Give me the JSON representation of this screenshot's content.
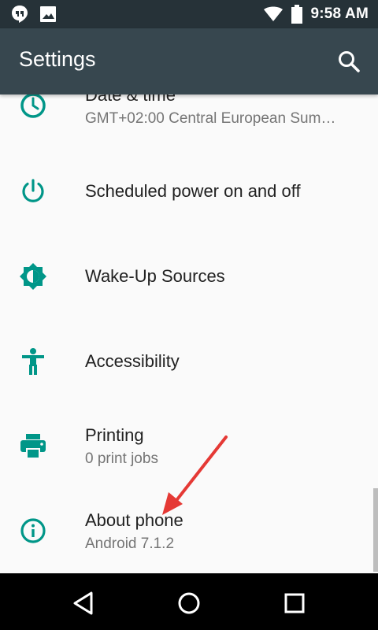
{
  "status_bar": {
    "time": "9:58 AM"
  },
  "app_bar": {
    "title": "Settings"
  },
  "settings_items": [
    {
      "key": "date-time",
      "title": "Date & time",
      "subtitle": "GMT+02:00 Central European Sum…",
      "icon": "clock-icon"
    },
    {
      "key": "scheduled-power",
      "title": "Scheduled power on and off",
      "icon": "power-icon"
    },
    {
      "key": "wake-up",
      "title": "Wake-Up Sources",
      "icon": "brightness-icon"
    },
    {
      "key": "accessibility",
      "title": "Accessibility",
      "icon": "accessibility-icon"
    },
    {
      "key": "printing",
      "title": "Printing",
      "subtitle": "0 print jobs",
      "icon": "printer-icon"
    },
    {
      "key": "about-phone",
      "title": "About phone",
      "subtitle": "Android 7.1.2",
      "icon": "info-icon"
    }
  ],
  "colors": {
    "status_bar": "#263238",
    "app_bar": "#37474f",
    "accent": "#009688",
    "annotation_arrow": "#e53935"
  }
}
